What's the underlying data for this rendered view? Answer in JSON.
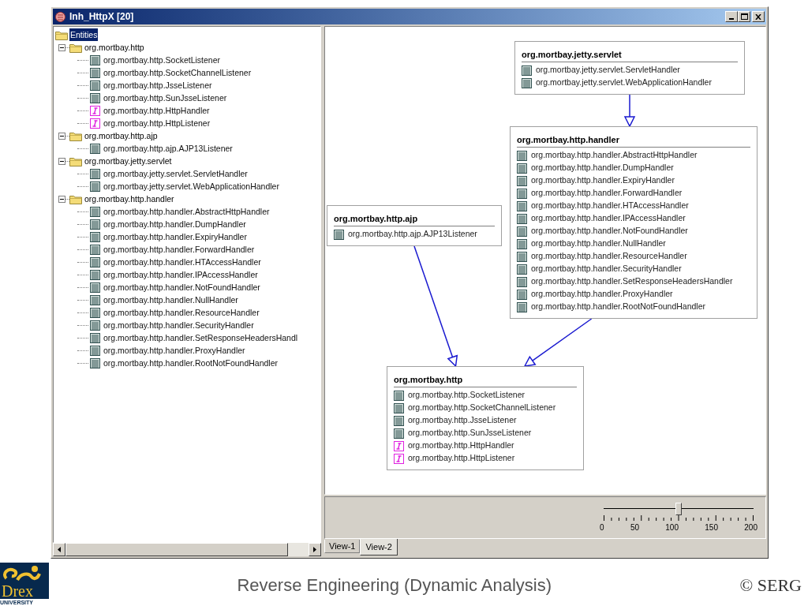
{
  "window": {
    "title": "Inh_HttpX [20]"
  },
  "tree": {
    "label": "Entities",
    "selected": true,
    "children": [
      {
        "label": "org.mortbay.http",
        "expanded": true,
        "children": [
          {
            "kind": "class",
            "label": "org.mortbay.http.SocketListener"
          },
          {
            "kind": "class",
            "label": "org.mortbay.http.SocketChannelListener"
          },
          {
            "kind": "class",
            "label": "org.mortbay.http.JsseListener"
          },
          {
            "kind": "class",
            "label": "org.mortbay.http.SunJsseListener"
          },
          {
            "kind": "interface",
            "label": "org.mortbay.http.HttpHandler"
          },
          {
            "kind": "interface",
            "label": "org.mortbay.http.HttpListener"
          }
        ]
      },
      {
        "label": "org.mortbay.http.ajp",
        "expanded": true,
        "children": [
          {
            "kind": "class",
            "label": "org.mortbay.http.ajp.AJP13Listener"
          }
        ]
      },
      {
        "label": "org.mortbay.jetty.servlet",
        "expanded": true,
        "children": [
          {
            "kind": "class",
            "label": "org.mortbay.jetty.servlet.ServletHandler"
          },
          {
            "kind": "class",
            "label": "org.mortbay.jetty.servlet.WebApplicationHandler"
          }
        ]
      },
      {
        "label": "org.mortbay.http.handler",
        "expanded": true,
        "children": [
          {
            "kind": "class",
            "label": "org.mortbay.http.handler.AbstractHttpHandler"
          },
          {
            "kind": "class",
            "label": "org.mortbay.http.handler.DumpHandler"
          },
          {
            "kind": "class",
            "label": "org.mortbay.http.handler.ExpiryHandler"
          },
          {
            "kind": "class",
            "label": "org.mortbay.http.handler.ForwardHandler"
          },
          {
            "kind": "class",
            "label": "org.mortbay.http.handler.HTAccessHandler"
          },
          {
            "kind": "class",
            "label": "org.mortbay.http.handler.IPAccessHandler"
          },
          {
            "kind": "class",
            "label": "org.mortbay.http.handler.NotFoundHandler"
          },
          {
            "kind": "class",
            "label": "org.mortbay.http.handler.NullHandler"
          },
          {
            "kind": "class",
            "label": "org.mortbay.http.handler.ResourceHandler"
          },
          {
            "kind": "class",
            "label": "org.mortbay.http.handler.SecurityHandler"
          },
          {
            "kind": "class",
            "label": "org.mortbay.http.handler.SetResponseHeadersHandl"
          },
          {
            "kind": "class",
            "label": "org.mortbay.http.handler.ProxyHandler"
          },
          {
            "kind": "class",
            "label": "org.mortbay.http.handler.RootNotFoundHandler"
          }
        ]
      }
    ]
  },
  "diagram": {
    "nodes": [
      {
        "title": "org.mortbay.jetty.servlet",
        "members": [
          {
            "kind": "class",
            "label": "org.mortbay.jetty.servlet.ServletHandler"
          },
          {
            "kind": "class",
            "label": "org.mortbay.jetty.servlet.WebApplicationHandler"
          }
        ]
      },
      {
        "title": "org.mortbay.http.ajp",
        "members": [
          {
            "kind": "class",
            "label": "org.mortbay.http.ajp.AJP13Listener"
          }
        ]
      },
      {
        "title": "org.mortbay.http.handler",
        "members": [
          {
            "kind": "class",
            "label": "org.mortbay.http.handler.AbstractHttpHandler"
          },
          {
            "kind": "class",
            "label": "org.mortbay.http.handler.DumpHandler"
          },
          {
            "kind": "class",
            "label": "org.mortbay.http.handler.ExpiryHandler"
          },
          {
            "kind": "class",
            "label": "org.mortbay.http.handler.ForwardHandler"
          },
          {
            "kind": "class",
            "label": "org.mortbay.http.handler.HTAccessHandler"
          },
          {
            "kind": "class",
            "label": "org.mortbay.http.handler.IPAccessHandler"
          },
          {
            "kind": "class",
            "label": "org.mortbay.http.handler.NotFoundHandler"
          },
          {
            "kind": "class",
            "label": "org.mortbay.http.handler.NullHandler"
          },
          {
            "kind": "class",
            "label": "org.mortbay.http.handler.ResourceHandler"
          },
          {
            "kind": "class",
            "label": "org.mortbay.http.handler.SecurityHandler"
          },
          {
            "kind": "class",
            "label": "org.mortbay.http.handler.SetResponseHeadersHandler"
          },
          {
            "kind": "class",
            "label": "org.mortbay.http.handler.ProxyHandler"
          },
          {
            "kind": "class",
            "label": "org.mortbay.http.handler.RootNotFoundHandler"
          }
        ]
      },
      {
        "title": "org.mortbay.http",
        "members": [
          {
            "kind": "class",
            "label": "org.mortbay.http.SocketListener"
          },
          {
            "kind": "class",
            "label": "org.mortbay.http.SocketChannelListener"
          },
          {
            "kind": "class",
            "label": "org.mortbay.http.JsseListener"
          },
          {
            "kind": "class",
            "label": "org.mortbay.http.SunJsseListener"
          },
          {
            "kind": "interface",
            "label": "org.mortbay.http.HttpHandler"
          },
          {
            "kind": "interface",
            "label": "org.mortbay.http.HttpListener"
          }
        ]
      }
    ]
  },
  "zoom_slider": {
    "level": 0.5,
    "tick_labels": [
      "0",
      "50",
      "100",
      "150",
      "200"
    ]
  },
  "tabs": [
    {
      "label": "View-1",
      "selected": false
    },
    {
      "label": "View-2",
      "selected": true
    }
  ],
  "slide": {
    "logo_text": "Drex",
    "logo_subtext": "UNIVERSITY",
    "footer": "Reverse Engineering (Dynamic Analysis)",
    "copyright": "© SERG"
  }
}
